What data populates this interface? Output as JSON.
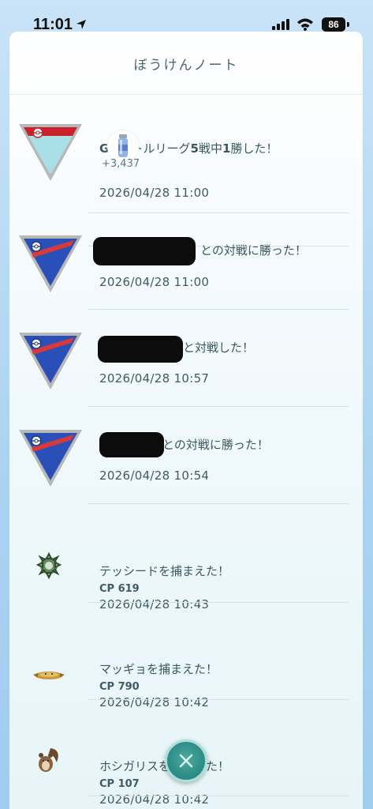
{
  "status_bar": {
    "time": "11:01",
    "battery": "86"
  },
  "header": {
    "title": "ぼうけんノート"
  },
  "entries": [
    {
      "title_prefix": "GO",
      "title_main": "バトルリーグ",
      "title_bold": "5",
      "title_mid": "戦中",
      "title_bold2": "1",
      "title_end": "勝した！",
      "reward": "+3,437",
      "date": "2026/04/28 11:00",
      "league": "great-league-red"
    },
    {
      "title": "との対戦に勝った！",
      "date": "2026/04/28 11:00",
      "league": "great-league-blue"
    },
    {
      "title": "と対戦した！",
      "date": "2026/04/28 10:57",
      "league": "great-league-blue"
    },
    {
      "title": "との対戦に勝った！",
      "date": "2026/04/28 10:54",
      "league": "great-league-blue"
    },
    {
      "title": "テッシードを捕まえた！",
      "cp": "CP 619",
      "date": "2026/04/28 10:43",
      "icon": "ferroseed"
    },
    {
      "title": "マッギョを捕まえた！",
      "cp": "CP 790",
      "date": "2026/04/28 10:42",
      "icon": "stunfisk"
    },
    {
      "title": "ホシガリスを捕まえた！",
      "cp": "CP 107",
      "date": "2026/04/28 10:42",
      "icon": "skwovet"
    }
  ],
  "colors": {
    "accent": "#2f8f88",
    "text": "#3f5b63"
  }
}
